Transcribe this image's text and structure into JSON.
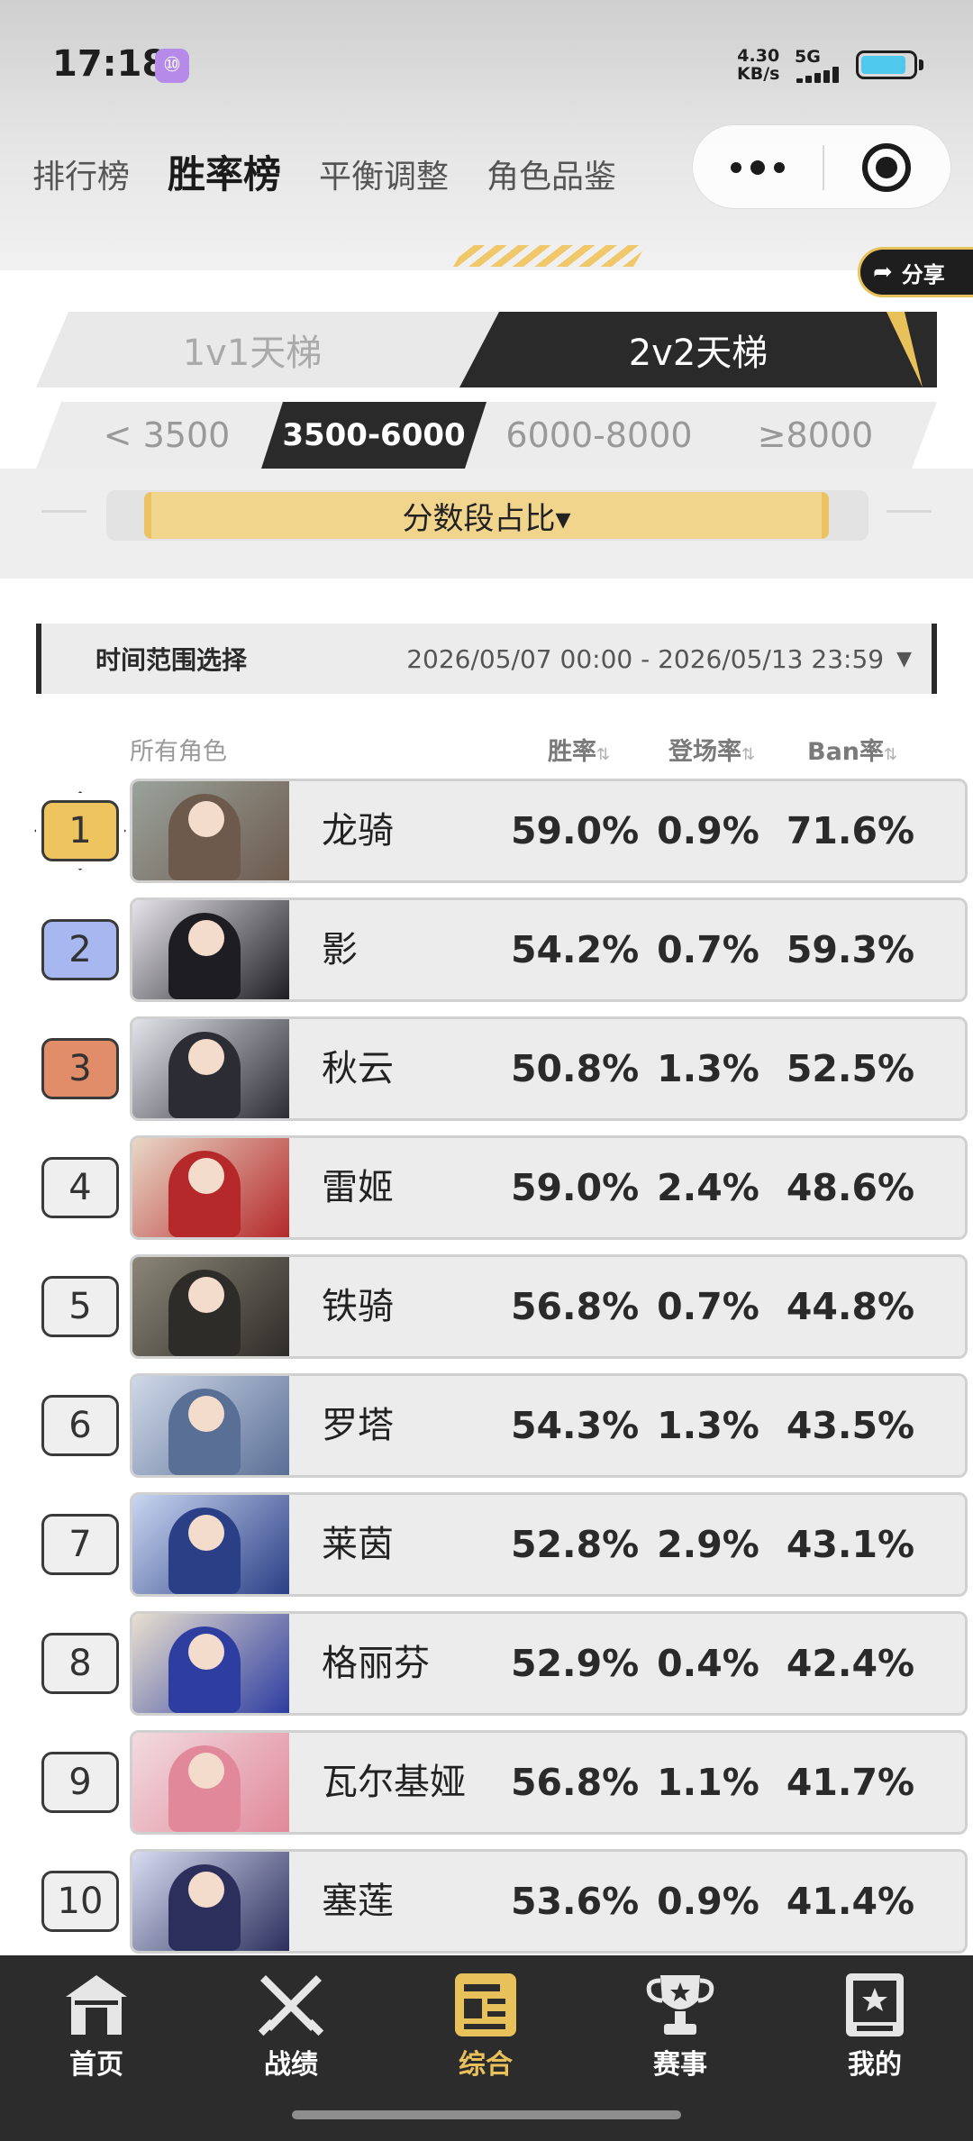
{
  "status_bar": {
    "time": "17:18",
    "net_speed_value": "4.30",
    "net_speed_unit": "KB/s",
    "network_type": "5G",
    "battery_level": 0.88,
    "app_badge": "⑩"
  },
  "top_nav": {
    "items": [
      {
        "label": "排行榜"
      },
      {
        "label": "胜率榜"
      },
      {
        "label": "平衡调整"
      },
      {
        "label": "角色品鉴"
      }
    ],
    "active_index": 1
  },
  "share": {
    "label": "分享",
    "icon": "share-arrow-icon"
  },
  "mode_tabs": [
    {
      "label": "1v1天梯"
    },
    {
      "label": "2v2天梯"
    }
  ],
  "mode_active_index": 1,
  "score_tabs": [
    {
      "label": "< 3500"
    },
    {
      "label": "3500-6000"
    },
    {
      "label": "6000-8000"
    },
    {
      "label": "≥8000"
    }
  ],
  "score_active_index": 1,
  "distribution_button": {
    "label": "分数段占比▾"
  },
  "time_range": {
    "label": "时间范围选择",
    "value": "2026/05/07 00:00 - 2026/05/13 23:59"
  },
  "table": {
    "headers": {
      "character": "所有角色",
      "win_rate": "胜率",
      "appearance_rate": "登场率",
      "ban_rate": "Ban率"
    },
    "rows": [
      {
        "rank": "1",
        "name": "龙骑",
        "win": "59.0%",
        "appear": "0.9%",
        "ban": "71.6%",
        "tier": "gold",
        "c1": "#6d5a4d",
        "c2": "#9aa39c"
      },
      {
        "rank": "2",
        "name": "影",
        "win": "54.2%",
        "appear": "0.7%",
        "ban": "59.3%",
        "tier": "blue",
        "c1": "#1d1d22",
        "c2": "#e6e4ea"
      },
      {
        "rank": "3",
        "name": "秋云",
        "win": "50.8%",
        "appear": "1.3%",
        "ban": "52.5%",
        "tier": "orange",
        "c1": "#2c2c34",
        "c2": "#e2e4ea"
      },
      {
        "rank": "4",
        "name": "雷姬",
        "win": "59.0%",
        "appear": "2.4%",
        "ban": "48.6%",
        "tier": "normal",
        "c1": "#b5292a",
        "c2": "#e9d8c6"
      },
      {
        "rank": "5",
        "name": "铁骑",
        "win": "56.8%",
        "appear": "0.7%",
        "ban": "44.8%",
        "tier": "normal",
        "c1": "#2e2c28",
        "c2": "#8b8678"
      },
      {
        "rank": "6",
        "name": "罗塔",
        "win": "54.3%",
        "appear": "1.3%",
        "ban": "43.5%",
        "tier": "normal",
        "c1": "#5a6f96",
        "c2": "#cfd8e8"
      },
      {
        "rank": "7",
        "name": "莱茵",
        "win": "52.8%",
        "appear": "2.9%",
        "ban": "43.1%",
        "tier": "normal",
        "c1": "#2b3f86",
        "c2": "#c8d6f0"
      },
      {
        "rank": "8",
        "name": "格丽芬",
        "win": "52.9%",
        "appear": "0.4%",
        "ban": "42.4%",
        "tier": "normal",
        "c1": "#2d3da0",
        "c2": "#e9e0d0"
      },
      {
        "rank": "9",
        "name": "瓦尔基娅",
        "win": "56.8%",
        "appear": "1.1%",
        "ban": "41.7%",
        "tier": "normal",
        "c1": "#e1899a",
        "c2": "#f2dbe0"
      },
      {
        "rank": "10",
        "name": "塞莲",
        "win": "53.6%",
        "appear": "0.9%",
        "ban": "41.4%",
        "tier": "normal",
        "c1": "#2c2f5c",
        "c2": "#d7dcf2"
      }
    ]
  },
  "bottom_nav": {
    "items": [
      {
        "label": "首页",
        "icon": "home-gate-icon"
      },
      {
        "label": "战绩",
        "icon": "crossed-swords-icon"
      },
      {
        "label": "综合",
        "icon": "newspaper-icon"
      },
      {
        "label": "赛事",
        "icon": "trophy-icon"
      },
      {
        "label": "我的",
        "icon": "profile-card-icon"
      }
    ],
    "active_index": 2
  },
  "colors": {
    "accent_gold": "#e9c15b",
    "dark": "#2a2a2a",
    "rank_gold": "#eec45e",
    "rank_blue": "#a7b7ef",
    "rank_orange": "#e18d6a"
  }
}
